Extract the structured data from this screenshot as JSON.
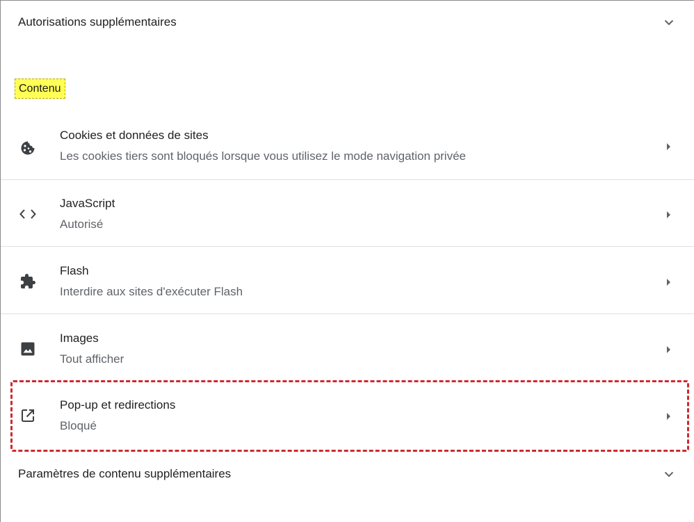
{
  "header_section": {
    "label": "Autorisations supplémentaires",
    "icon": "chevron-down-icon"
  },
  "content_section": {
    "title": "Contenu",
    "items": [
      {
        "title": "Cookies et données de sites",
        "subtitle": "Les cookies tiers sont bloqués lorsque vous utilisez le mode navigation privée",
        "icon": "cookie-icon"
      },
      {
        "title": "JavaScript",
        "subtitle": "Autorisé",
        "icon": "code-icon"
      },
      {
        "title": "Flash",
        "subtitle": "Interdire aux sites d'exécuter Flash",
        "icon": "puzzle-icon"
      },
      {
        "title": "Images",
        "subtitle": "Tout afficher",
        "icon": "image-icon"
      },
      {
        "title": "Pop-up et redirections",
        "subtitle": "Bloqué",
        "icon": "open-in-new-icon"
      }
    ]
  },
  "footer_section": {
    "label": "Paramètres de contenu supplémentaires",
    "icon": "chevron-down-icon"
  },
  "colors": {
    "highlight_fill": "#ffff55",
    "annotation_border": "#cc2a30",
    "icon": "#3c4043",
    "secondary_text": "#5f6368"
  }
}
